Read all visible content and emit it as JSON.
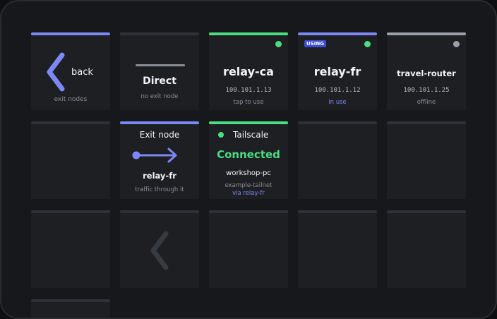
{
  "back_tile": {
    "label": "back",
    "sub": "exit nodes",
    "icon": "chevron-left-icon"
  },
  "direct_tile": {
    "title": "Direct",
    "sub": "no exit node"
  },
  "nodes": [
    {
      "name": "relay-ca",
      "ip": "100.101.1.13",
      "status": "tap to use",
      "status_color": "#4ade80"
    },
    {
      "name": "relay-fr",
      "ip": "100.101.1.12",
      "status": "in use",
      "badge": "USING",
      "status_color": "#4ade80"
    },
    {
      "name": "travel-router",
      "ip": "100.101.1.25",
      "status": "offline",
      "status_color": "#9aa0a6"
    }
  ],
  "exit_node_tile": {
    "heading": "Exit node",
    "node": "relay-fr",
    "sub": "traffic through it",
    "icon": "arrow-right-icon"
  },
  "tailscale_tile": {
    "brand": "Tailscale",
    "state": "Connected",
    "device": "workshop-pc",
    "tailnet": "example-tailnet",
    "via": "via relay-fr"
  },
  "nav": {
    "prev_icon": "chevron-left-icon"
  },
  "colors": {
    "accent": "#7b88f5",
    "connected": "#4ade80",
    "offline": "#9aa0a6",
    "badge": "#3d4bd8"
  }
}
